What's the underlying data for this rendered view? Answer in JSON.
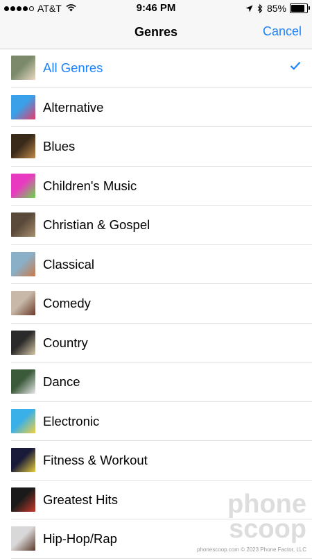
{
  "status_bar": {
    "carrier": "AT&T",
    "time": "9:46 PM",
    "battery": "85%",
    "battery_level": 0.85,
    "signal_dots": 4
  },
  "nav": {
    "title": "Genres",
    "cancel_label": "Cancel"
  },
  "colors": {
    "accent": "#1a82fb",
    "separator": "#e0e0e0",
    "bar_background": "#f7f7f7"
  },
  "genres": [
    {
      "label": "All Genres",
      "selected": true,
      "thumb": [
        "#7a8a6a",
        "#e8d8c0"
      ]
    },
    {
      "label": "Alternative",
      "selected": false,
      "thumb": [
        "#3aa0e8",
        "#e83a6a"
      ]
    },
    {
      "label": "Blues",
      "selected": false,
      "thumb": [
        "#3a2a1a",
        "#c08a4a"
      ]
    },
    {
      "label": "Children's Music",
      "selected": false,
      "thumb": [
        "#e83ac0",
        "#6ad84a"
      ]
    },
    {
      "label": "Christian & Gospel",
      "selected": false,
      "thumb": [
        "#5a4a3a",
        "#a89070"
      ]
    },
    {
      "label": "Classical",
      "selected": false,
      "thumb": [
        "#8ab0c8",
        "#c87a4a"
      ]
    },
    {
      "label": "Comedy",
      "selected": false,
      "thumb": [
        "#c8b8a8",
        "#6a3a2a"
      ]
    },
    {
      "label": "Country",
      "selected": false,
      "thumb": [
        "#2a2a2a",
        "#d8c8a8"
      ]
    },
    {
      "label": "Dance",
      "selected": false,
      "thumb": [
        "#3a5a3a",
        "#e8e8e8"
      ]
    },
    {
      "label": "Electronic",
      "selected": false,
      "thumb": [
        "#3ab0e8",
        "#f0d040"
      ]
    },
    {
      "label": "Fitness & Workout",
      "selected": false,
      "thumb": [
        "#1a1a3a",
        "#e8d03a"
      ]
    },
    {
      "label": "Greatest Hits",
      "selected": false,
      "thumb": [
        "#1a1a1a",
        "#c83a2a"
      ]
    },
    {
      "label": "Hip-Hop/Rap",
      "selected": false,
      "thumb": [
        "#d8d8d8",
        "#5a3a2a"
      ]
    }
  ],
  "watermark": {
    "line1": "phone",
    "line2": "scoop",
    "footer": "phonescoop.com © 2023 Phone Factor, LLC"
  }
}
